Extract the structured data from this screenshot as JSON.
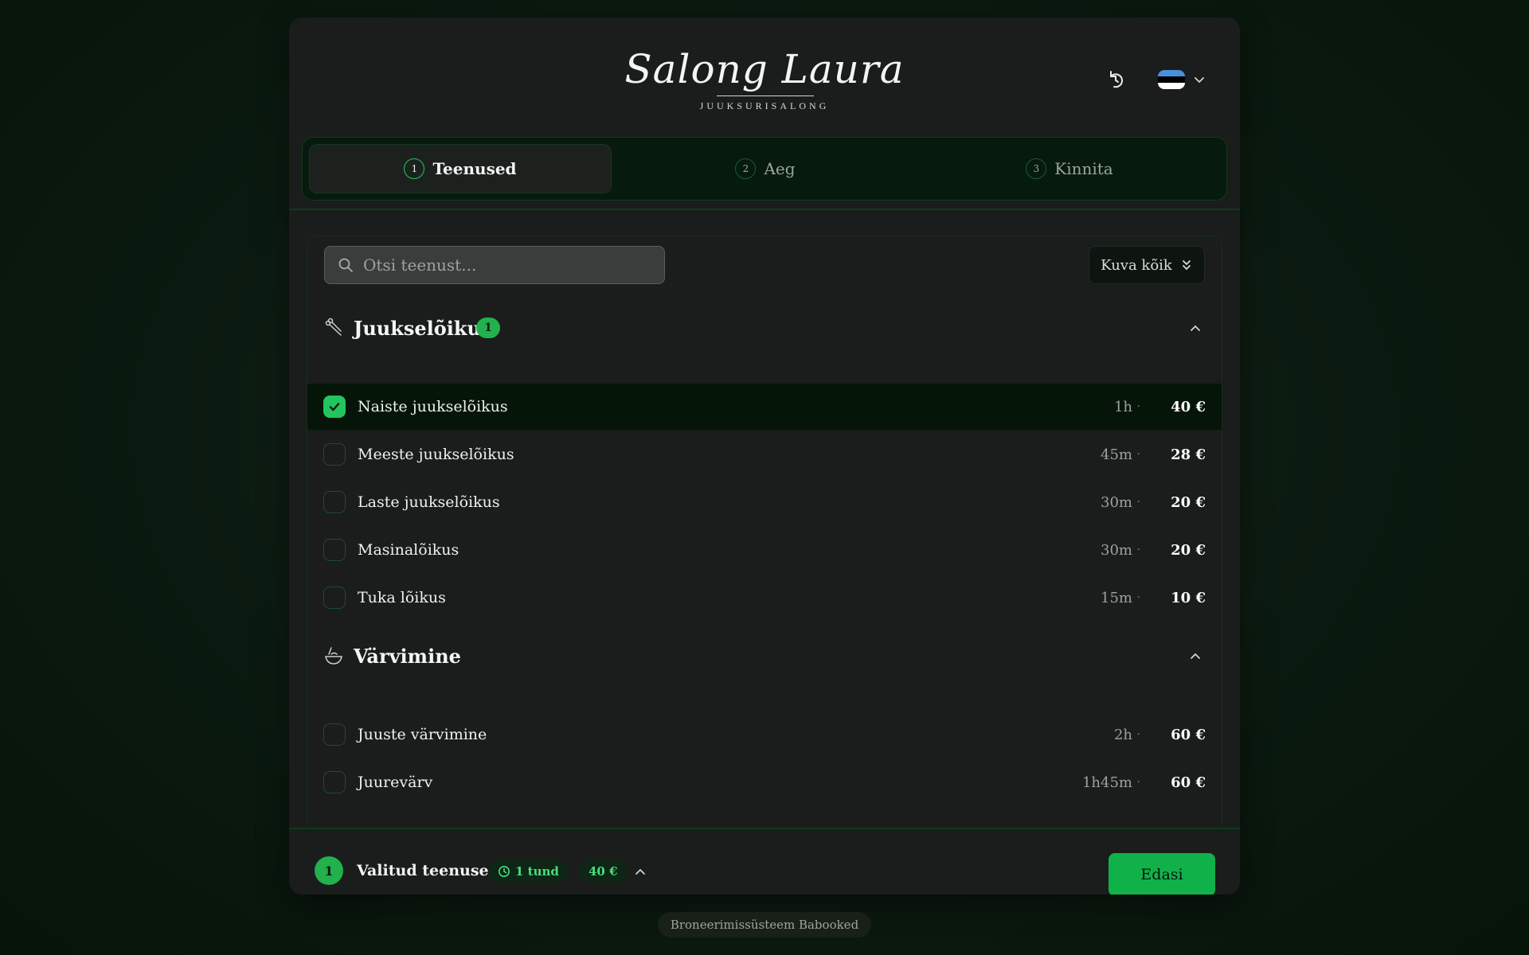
{
  "brand": {
    "name": "Salong Laura",
    "subtitle": "JUUKSURISALONG"
  },
  "header": {
    "history_icon": "history-icon",
    "language": {
      "flag": "flag-estonia",
      "flag_colors": [
        "#4891d9",
        "#000000",
        "#ffffff"
      ],
      "chevron_icon": "chevron-down-icon"
    }
  },
  "steps": [
    {
      "number": "1",
      "label": "Teenused",
      "active": true
    },
    {
      "number": "2",
      "label": "Aeg",
      "active": false
    },
    {
      "number": "3",
      "label": "Kinnita",
      "active": false
    }
  ],
  "search": {
    "placeholder": "Otsi teenust...",
    "value": "",
    "icon": "search-icon"
  },
  "show_all": {
    "label": "Kuva kõik",
    "icon": "chevrons-down-icon"
  },
  "categories": [
    {
      "title": "Juukselõikus",
      "icon": "scissors-icon",
      "badge": "1",
      "expanded": true,
      "services": [
        {
          "name": "Naiste juukselõikus",
          "duration": "1h",
          "price": "40 €",
          "selected": true
        },
        {
          "name": "Meeste juukselõikus",
          "duration": "45m",
          "price": "28 €",
          "selected": false
        },
        {
          "name": "Laste juukselõikus",
          "duration": "30m",
          "price": "20 €",
          "selected": false
        },
        {
          "name": "Masinalõikus",
          "duration": "30m",
          "price": "20 €",
          "selected": false
        },
        {
          "name": "Tuka lõikus",
          "duration": "15m",
          "price": "10 €",
          "selected": false
        }
      ]
    },
    {
      "title": "Värvimine",
      "icon": "dye-bowl-icon",
      "badge": "",
      "expanded": true,
      "services": [
        {
          "name": "Juuste värvimine",
          "duration": "2h",
          "price": "60 €",
          "selected": false
        },
        {
          "name": "Juurevärv",
          "duration": "1h45m",
          "price": "60 €",
          "selected": false
        }
      ]
    }
  ],
  "footer": {
    "count": "1",
    "label": "Valitud teenused",
    "duration": "1 tund",
    "total": "40 €",
    "next_button": "Edasi"
  },
  "powered_by": "Broneerimissüsteem Babooked",
  "colors": {
    "accent": "#22c55e",
    "button": "#11b14a",
    "background": "#1a1d1b"
  }
}
